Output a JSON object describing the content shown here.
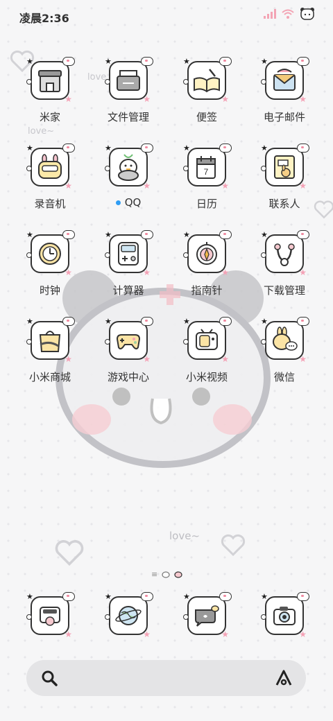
{
  "status_bar": {
    "time": "凌晨2:36"
  },
  "apps": [
    {
      "label": "米家",
      "icon": "mi-home-icon"
    },
    {
      "label": "文件管理",
      "icon": "file-manager-icon"
    },
    {
      "label": "便签",
      "icon": "notes-icon"
    },
    {
      "label": "电子邮件",
      "icon": "email-icon"
    },
    {
      "label": "录音机",
      "icon": "recorder-icon"
    },
    {
      "label": "QQ",
      "icon": "qq-icon"
    },
    {
      "label": "日历",
      "icon": "calendar-icon",
      "calendar_day": "7"
    },
    {
      "label": "联系人",
      "icon": "contacts-icon"
    },
    {
      "label": "时钟",
      "icon": "clock-icon"
    },
    {
      "label": "计算器",
      "icon": "calculator-icon"
    },
    {
      "label": "指南针",
      "icon": "compass-icon"
    },
    {
      "label": "下载管理",
      "icon": "download-icon"
    },
    {
      "label": "小米商城",
      "icon": "mi-store-icon"
    },
    {
      "label": "游戏中心",
      "icon": "game-center-icon"
    },
    {
      "label": "小米视频",
      "icon": "mi-video-icon"
    },
    {
      "label": "微信",
      "icon": "wechat-icon"
    }
  ],
  "dock": [
    {
      "icon": "camera-roll-icon"
    },
    {
      "icon": "browser-globe-icon"
    },
    {
      "icon": "messages-icon"
    },
    {
      "icon": "camera-icon"
    }
  ],
  "wallpaper_text": [
    "love~",
    "love",
    "love~"
  ],
  "colors": {
    "accent_pink": "#f4a2b6",
    "qq_dot": "#2f9df4",
    "outline": "#333333"
  }
}
